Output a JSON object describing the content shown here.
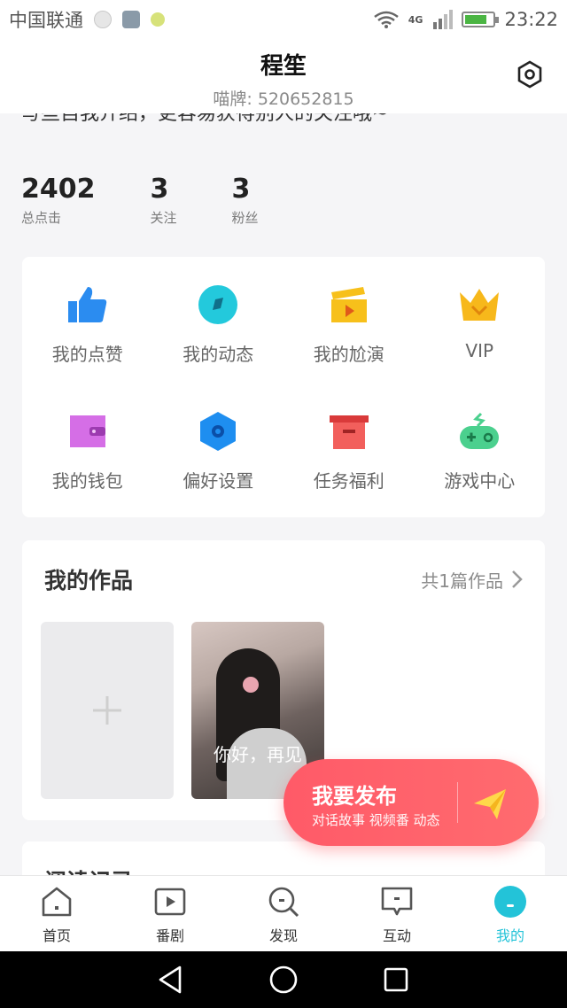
{
  "status_bar": {
    "carrier": "中国联通",
    "network": "4G",
    "time": "23:22"
  },
  "header": {
    "name": "程笙",
    "id_line": "喵牌: 520652815"
  },
  "truncated_text": "写些自我介绍，更容易获得别人的关注哦~",
  "stats": [
    {
      "value": "2402",
      "label": "总点击"
    },
    {
      "value": "3",
      "label": "关注"
    },
    {
      "value": "3",
      "label": "粉丝"
    }
  ],
  "grid": [
    {
      "label": "我的点赞",
      "icon": "thumbs-up-icon",
      "color": "#2b8cf0"
    },
    {
      "label": "我的动态",
      "icon": "compass-icon",
      "color": "#23c9dc"
    },
    {
      "label": "我的尬演",
      "icon": "clapperboard-icon",
      "color": "#f7c01b"
    },
    {
      "label": "VIP",
      "icon": "crown-icon",
      "color": "#f7b81b"
    },
    {
      "label": "我的钱包",
      "icon": "wallet-icon",
      "color": "#d56ee6"
    },
    {
      "label": "偏好设置",
      "icon": "hexagon-settings-icon",
      "color": "#1e8ef0"
    },
    {
      "label": "任务福利",
      "icon": "gift-box-icon",
      "color": "#f25f5c"
    },
    {
      "label": "游戏中心",
      "icon": "gamepad-icon",
      "color": "#4bd08e"
    }
  ],
  "works": {
    "title": "我的作品",
    "count": "共1篇作品",
    "items": [
      {
        "caption": "你好，再见"
      }
    ]
  },
  "reading": {
    "title": "阅读记录"
  },
  "fab": {
    "title": "我要发布",
    "subtitle": "对话故事 视频番 动态"
  },
  "tabs": [
    {
      "label": "首页",
      "icon": "home-icon"
    },
    {
      "label": "番剧",
      "icon": "play-icon"
    },
    {
      "label": "发现",
      "icon": "search-icon"
    },
    {
      "label": "互动",
      "icon": "chat-icon"
    },
    {
      "label": "我的",
      "icon": "profile-icon",
      "active": true
    }
  ],
  "colors": {
    "accent": "#23c3d8",
    "fab": "#ff5a68"
  }
}
